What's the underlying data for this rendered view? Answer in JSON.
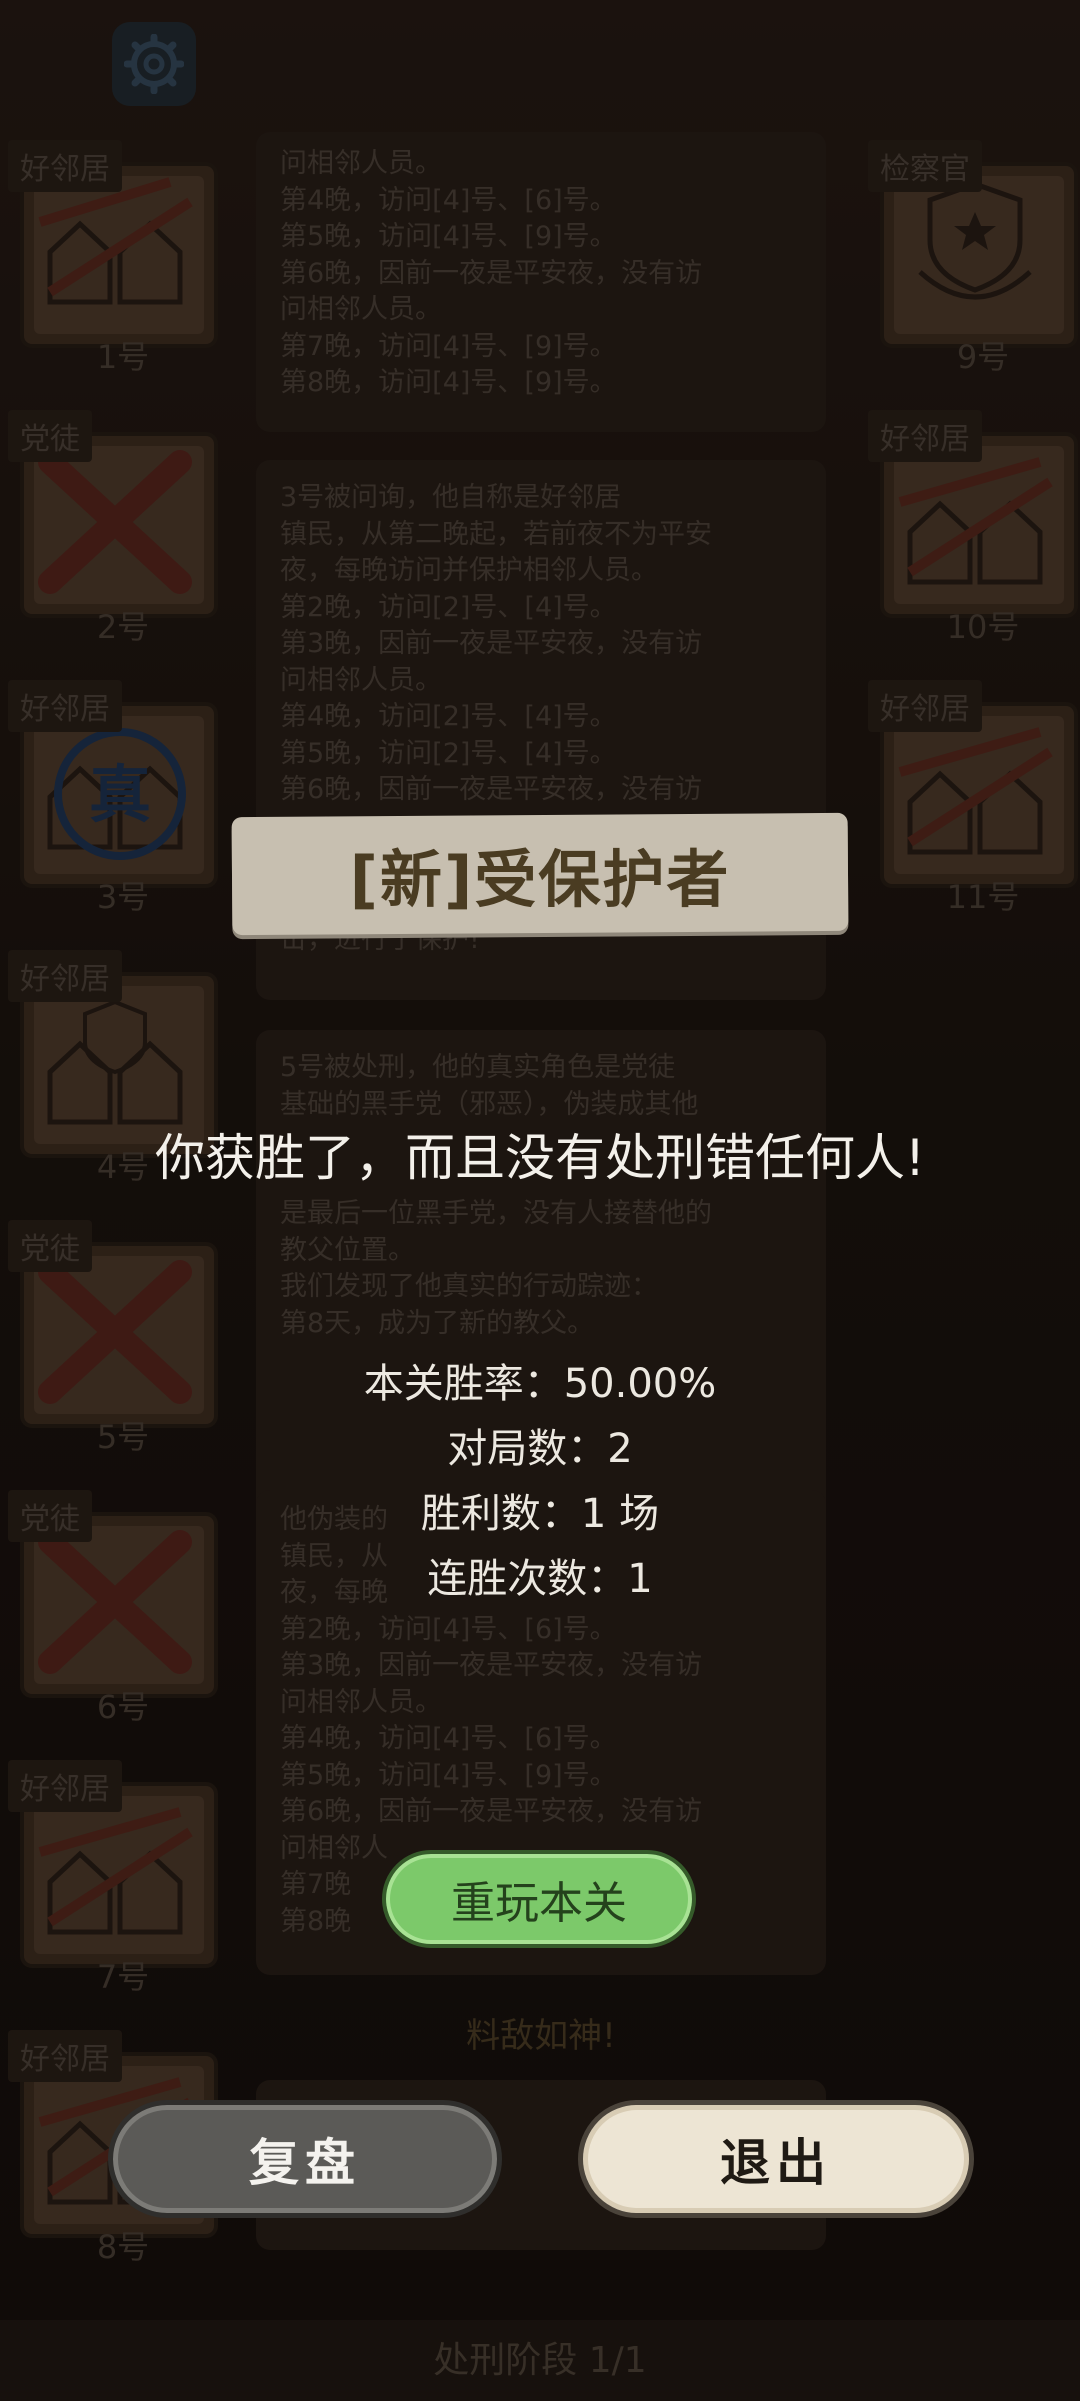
{
  "icons": {
    "settings": "gear-icon",
    "truth_stamp": "truth-stamp-icon"
  },
  "colors": {
    "replay_green": "#7cc96a",
    "banner": "#c7bfb0",
    "exit_cream": "#ede5d4"
  },
  "cards": [
    {
      "role": "好邻居",
      "num": "1号"
    },
    {
      "role": "党徒",
      "num": "2号"
    },
    {
      "role": "好邻居",
      "num": "3号",
      "stamp": "真"
    },
    {
      "role": "好邻居",
      "num": "4号"
    },
    {
      "role": "党徒",
      "num": "5号"
    },
    {
      "role": "党徒",
      "num": "6号"
    },
    {
      "role": "好邻居",
      "num": "7号"
    },
    {
      "role": "好邻居",
      "num": "8号"
    },
    {
      "role": "检察官",
      "num": "9号"
    },
    {
      "role": "好邻居",
      "num": "10号"
    },
    {
      "role": "好邻居",
      "num": "11号"
    }
  ],
  "log": {
    "p1": [
      "问相邻人员。",
      "第4晚，访问[4]号、[6]号。",
      "第5晚，访问[4]号、[9]号。",
      "第6晚，因前一夜是平安夜，没有访",
      "问相邻人员。",
      "第7晚，访问[4]号、[9]号。",
      "第8晚，访问[4]号、[9]号。"
    ],
    "p2": [
      "3号被问询，他自称是好邻居",
      "镇民，从第二晚起，若前夜不为平安",
      "夜，每晚访问并保护相邻人员。",
      "第2晚，访问[2]号、[4]号。",
      "第3晚，因前一夜是平安夜，没有访",
      "问相邻人员。",
      "第4晚，访问[2]号、[4]号。",
      "第5晚，访问[2]号、[4]号。",
      "第6晚，因前一夜是平安夜，没有访"
    ],
    "p2_tail": "击，进行了保护!",
    "p3": [
      "5号被处刑，他的真实角色是党徒",
      "基础的黑手党（邪恶），伪装成其他"
    ],
    "p3b": [
      "是最后一位黑手党，没有人接替他的",
      "教父位置。",
      "我们发现了他真实的行动踪迹：",
      "第8天，成为了新的教父。"
    ],
    "p4": [
      "他伪装的",
      "镇民，从",
      "夜，每晚",
      "第2晚，访问[4]号、[6]号。",
      "第3晚，因前一夜是平安夜，没有访",
      "问相邻人员。",
      "第4晚，访问[4]号、[6]号。",
      "第5晚，访问[4]号、[9]号。",
      "第6晚，因前一夜是平安夜，没有访",
      "问相邻人",
      "第7晚",
      "第8晚"
    ],
    "center_title": "料敌如神!",
    "footer": "处刑阶段 1/1"
  },
  "dialog": {
    "banner": "[新]受保护者",
    "result": "你获胜了，而且没有处刑错任何人!",
    "stats": {
      "win_rate": "本关胜率：50.00%",
      "games": "对局数：2",
      "wins": "胜利数：1 场",
      "streak": "连胜次数：1"
    },
    "replay": "重玩本关",
    "review": "复盘",
    "exit": "退出"
  }
}
